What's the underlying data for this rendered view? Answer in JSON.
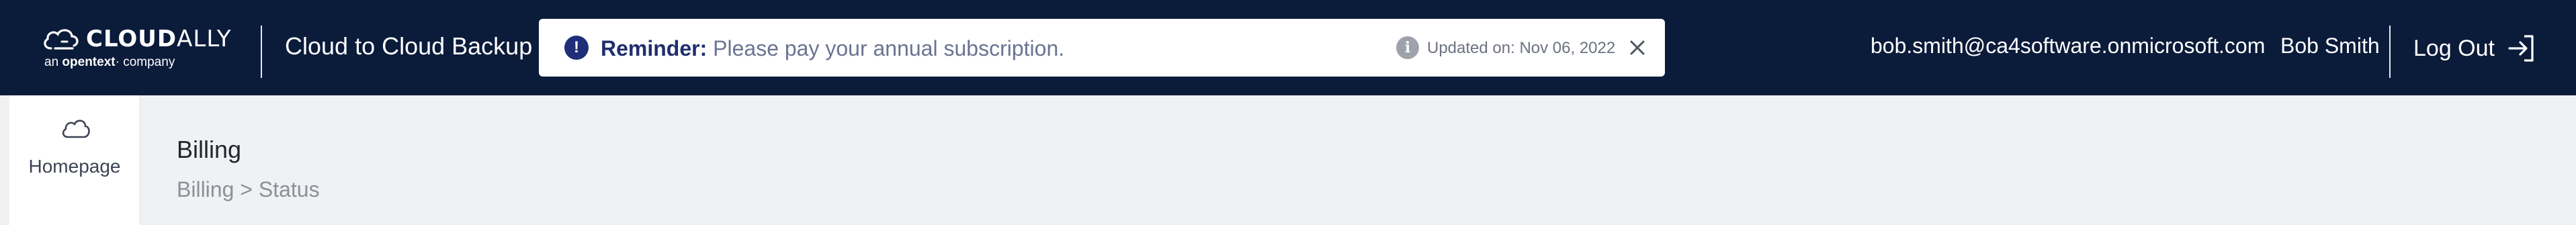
{
  "brand": {
    "logo_text_bold": "CLOUD",
    "logo_text_light": "ALLY",
    "tagline_prefix": "an",
    "tagline_brand": "opentext",
    "tagline_suffix": "company",
    "product_title": "Cloud to Cloud Backup",
    "header_bg": "#0b1b3a"
  },
  "reminder": {
    "label": "Reminder:",
    "message": "Please pay your annual subscription.",
    "updated_text": "Updated on: Nov 06, 2022",
    "alert_icon": "exclamation-circle-icon",
    "info_icon": "info-circle-icon",
    "close_icon": "close-icon",
    "accent": "#1f2e78"
  },
  "user": {
    "email": "bob.smith@ca4software.onmicrosoft.com",
    "name": "Bob Smith",
    "logout_label": "Log Out",
    "logout_icon": "logout-icon"
  },
  "sidebar": {
    "items": [
      {
        "label": "Homepage",
        "icon": "cloud-icon"
      }
    ]
  },
  "main": {
    "title": "Billing",
    "breadcrumb": {
      "parent": "Billing",
      "separator": ">",
      "current": "Status"
    }
  }
}
